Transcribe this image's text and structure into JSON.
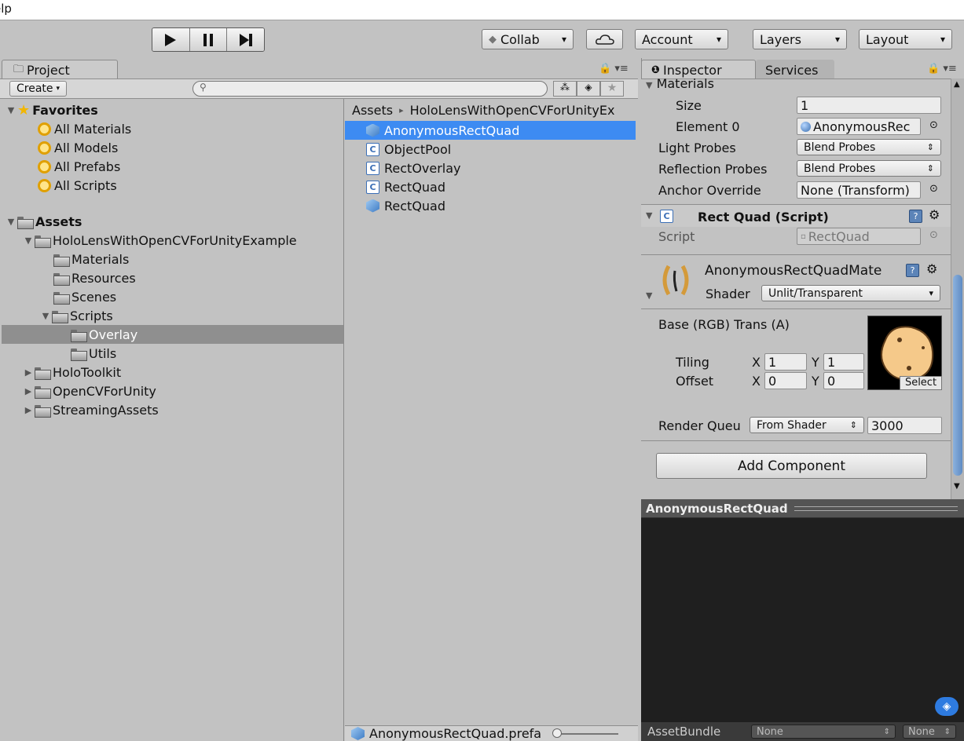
{
  "menubar": {
    "fragment": "elp"
  },
  "toolbar": {
    "collab": "Collab",
    "account": "Account",
    "layers": "Layers",
    "layout": "Layout"
  },
  "project": {
    "tab": "Project",
    "create": "Create",
    "favorites_header": "Favorites",
    "favorites": [
      "All Materials",
      "All Models",
      "All Prefabs",
      "All Scripts"
    ],
    "assets_header": "Assets",
    "tree": {
      "holo": "HoloLensWithOpenCVForUnityExample",
      "materials": "Materials",
      "resources": "Resources",
      "scenes": "Scenes",
      "scripts": "Scripts",
      "overlay": "Overlay",
      "utils": "Utils",
      "holotoolkit": "HoloToolkit",
      "opencv": "OpenCVForUnity",
      "streaming": "StreamingAssets"
    },
    "breadcrumb": {
      "root": "Assets",
      "sep": "▸",
      "current": "HoloLensWithOpenCVForUnityEx"
    },
    "files": [
      "AnonymousRectQuad",
      "ObjectPool",
      "RectOverlay",
      "RectQuad",
      "RectQuad"
    ],
    "footer_file": "AnonymousRectQuad.prefa"
  },
  "inspector": {
    "tab": "Inspector",
    "services_tab": "Services",
    "materials_header": "Materials",
    "size_label": "Size",
    "size_value": "1",
    "element0_label": "Element 0",
    "element0_value": "AnonymousRec",
    "light_probes_label": "Light Probes",
    "light_probes_value": "Blend Probes",
    "reflection_probes_label": "Reflection Probes",
    "reflection_probes_value": "Blend Probes",
    "anchor_label": "Anchor Override",
    "anchor_value": "None (Transform)",
    "rect_quad_header": "Rect Quad (Script)",
    "script_label": "Script",
    "script_value": "RectQuad",
    "material_name": "AnonymousRectQuadMate",
    "shader_label": "Shader",
    "shader_value": "Unlit/Transparent",
    "base_label": "Base (RGB) Trans (A)",
    "tiling_label": "Tiling",
    "offset_label": "Offset",
    "x_label": "X",
    "y_label": "Y",
    "tiling_x": "1",
    "tiling_y": "1",
    "offset_x": "0",
    "offset_y": "0",
    "select_label": "Select",
    "render_queue_label": "Render Queu",
    "render_queue_mode": "From Shader",
    "render_queue_value": "3000",
    "add_component": "Add Component"
  },
  "preview": {
    "title": "AnonymousRectQuad",
    "assetbundle_label": "AssetBundle",
    "assetbundle_value": "None",
    "variant_value": "None"
  }
}
